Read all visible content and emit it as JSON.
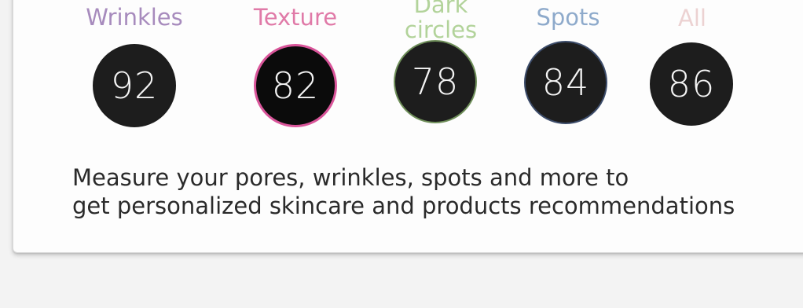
{
  "metrics": [
    {
      "label": "Wrinkles",
      "value": "92",
      "label_color": "#a78bbd",
      "ring_color": "#1d1d1d"
    },
    {
      "label": "Texture",
      "value": "82",
      "label_color": "#e07aa8",
      "ring_color": "#d9559a"
    },
    {
      "label_line1": "Dark",
      "label_line2": "circles",
      "value": "78",
      "label_color": "#b2d39a",
      "ring_color": "#6f8f5a"
    },
    {
      "label": "Spots",
      "value": "84",
      "label_color": "#8eaacb",
      "ring_color": "#3c4c6a"
    },
    {
      "label": "All",
      "value": "86",
      "label_color": "#ecd2d2",
      "ring_color": "#1d1d1d"
    }
  ],
  "description": {
    "line1": "Measure your pores, wrinkles, spots and more to",
    "line2": "get personalized skincare and products recommendations"
  }
}
